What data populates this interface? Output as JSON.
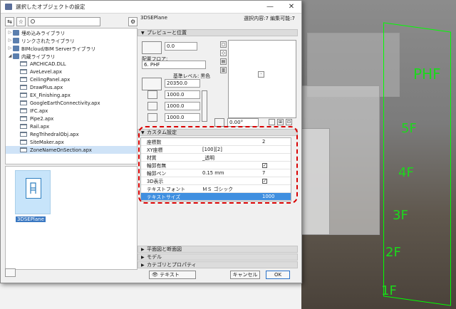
{
  "window": {
    "title": "選択したオブジェクトの設定",
    "minimize": "—",
    "close": "✕"
  },
  "left": {
    "search_placeholder": "",
    "tree": [
      {
        "label": "埋め込みライブラリ",
        "level": 0,
        "type": "lib"
      },
      {
        "label": "リンクされたライブラリ",
        "level": 0,
        "type": "lib"
      },
      {
        "label": "BIMcloud/BIM Serverライブラリ",
        "level": 0,
        "type": "lib"
      },
      {
        "label": "内蔵ライブラリ",
        "level": 0,
        "type": "lib",
        "open": true
      },
      {
        "label": "ARCHICAD.DLL",
        "level": 1,
        "type": "folder"
      },
      {
        "label": "AveLevel.apx",
        "level": 1,
        "type": "folder"
      },
      {
        "label": "CeilingPanel.apx",
        "level": 1,
        "type": "folder"
      },
      {
        "label": "DrawPlus.apx",
        "level": 1,
        "type": "folder"
      },
      {
        "label": "EX_Finishing.apx",
        "level": 1,
        "type": "folder"
      },
      {
        "label": "GoogleEarthConnectivity.apx",
        "level": 1,
        "type": "folder"
      },
      {
        "label": "IFC.apx",
        "level": 1,
        "type": "folder"
      },
      {
        "label": "Pipe2.apx",
        "level": 1,
        "type": "folder"
      },
      {
        "label": "Rail.apx",
        "level": 1,
        "type": "folder"
      },
      {
        "label": "RegTrihedralObj.apx",
        "level": 1,
        "type": "folder"
      },
      {
        "label": "SiteMaker.apx",
        "level": 1,
        "type": "folder"
      },
      {
        "label": "ZoneNameOnSection.apx",
        "level": 1,
        "type": "folder",
        "selected": true
      }
    ],
    "thumbnail_label": "3DSEPlane"
  },
  "right": {
    "object_name": "3DSEPlane",
    "selection_info": "選択内容:7 編集可能:7",
    "sections": {
      "preview": "プレビューと位置",
      "custom": "カスタム設定",
      "plan_section": "平面図と断面図",
      "model": "モデル",
      "category": "カテゴリとプロパティ"
    },
    "fields": {
      "offset": "0.0",
      "home_floor_label": "配置フロア:",
      "home_floor": "6. PHF",
      "ref_level_label": "基準レベル: 黒色",
      "elevation": "20350.0",
      "width": "1000.0",
      "depth": "1000.0",
      "height": "1000.0",
      "angle": "0.00°"
    },
    "params": [
      {
        "name": "座標数",
        "value": "",
        "extra": "2"
      },
      {
        "name": "XY座標",
        "value": "[100][2]",
        "extra": ""
      },
      {
        "name": "材質",
        "value": "_透明",
        "extra": ""
      },
      {
        "name": "輪郭有無",
        "value": "",
        "extra": "✓"
      },
      {
        "name": "輪郭ペン",
        "value": "0.15 mm",
        "extra": "7"
      },
      {
        "name": "3D表示",
        "value": "",
        "extra": "✓"
      },
      {
        "name": "テキストフォント",
        "value": "ＭＳ ゴシック",
        "extra": ""
      },
      {
        "name": "テキストサイズ",
        "value": "",
        "extra": "1000"
      }
    ],
    "footer": {
      "layer": "テキスト",
      "cancel": "キャンセル",
      "ok": "OK"
    }
  },
  "scene": {
    "labels": [
      "PHF",
      "5F",
      "4F",
      "3F",
      "2F",
      "1F"
    ],
    "grid_color": "#18e018"
  }
}
